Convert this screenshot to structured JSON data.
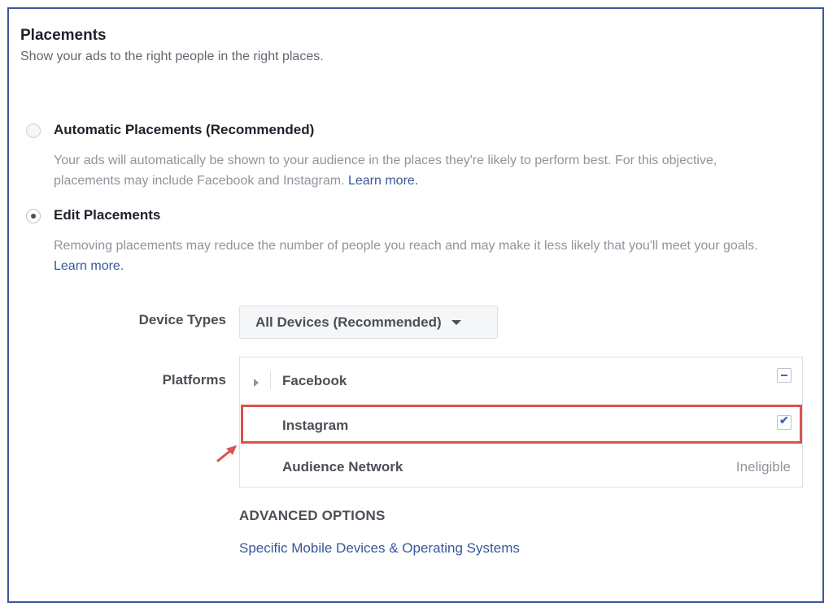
{
  "header": {
    "title": "Placements",
    "subtitle": "Show your ads to the right people in the right places."
  },
  "options": {
    "automatic": {
      "label": "Automatic Placements (Recommended)",
      "description": "Your ads will automatically be shown to your audience in the places they're likely to perform best. For this objective, placements may include Facebook and Instagram.",
      "learn_more": "Learn more.",
      "selected": false
    },
    "edit": {
      "label": "Edit Placements",
      "description": "Removing placements may reduce the number of people you reach and may make it less likely that you'll meet your goals.",
      "learn_more": "Learn more.",
      "selected": true
    }
  },
  "device_types": {
    "label": "Device Types",
    "value": "All Devices (Recommended)"
  },
  "platforms": {
    "label": "Platforms",
    "items": [
      {
        "name": "Facebook",
        "state": "partial"
      },
      {
        "name": "Instagram",
        "state": "checked"
      },
      {
        "name": "Audience Network",
        "state": "ineligible",
        "status_text": "Ineligible"
      }
    ]
  },
  "advanced": {
    "title": "ADVANCED OPTIONS",
    "link": "Specific Mobile Devices & Operating Systems"
  },
  "colors": {
    "frame_border": "#3b5998",
    "link": "#365899",
    "highlight": "#d9534f",
    "checkbox_accent": "#4267b2"
  }
}
